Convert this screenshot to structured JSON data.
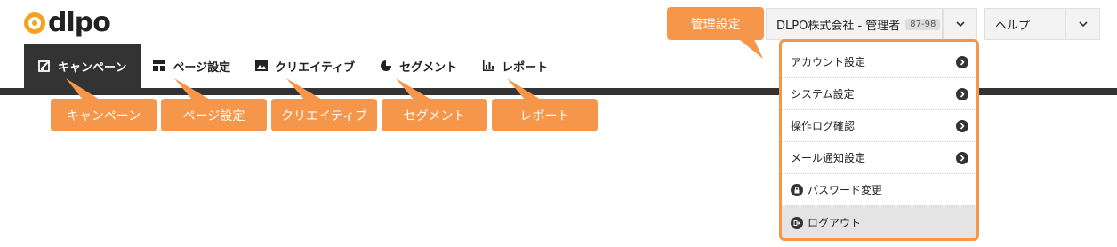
{
  "brand": {
    "logo_text": "dlpo",
    "accent": "#f5a31c",
    "callout_color": "#f5964a"
  },
  "nav": {
    "items": [
      {
        "label": "キャンペーン",
        "icon": "campaign-edit-icon",
        "active": true
      },
      {
        "label": "ページ設定",
        "icon": "layout-icon",
        "active": false
      },
      {
        "label": "クリエイティブ",
        "icon": "image-icon",
        "active": false
      },
      {
        "label": "セグメント",
        "icon": "pie-chart-icon",
        "active": false
      },
      {
        "label": "レポート",
        "icon": "bar-chart-icon",
        "active": false
      }
    ]
  },
  "callouts": {
    "campaign": "キャンペーン",
    "page_settings": "ページ設定",
    "creative": "クリエイティブ",
    "segment": "セグメント",
    "report": "レポート",
    "admin_settings": "管理設定"
  },
  "header": {
    "company_label": "DLPO株式会社 - 管理者",
    "company_badge": "87-98",
    "help_label": "ヘルプ"
  },
  "dropdown": {
    "items": [
      {
        "label": "アカウント設定",
        "icon": "chevron-right-circle-icon"
      },
      {
        "label": "システム設定",
        "icon": "chevron-right-circle-icon"
      },
      {
        "label": "操作ログ確認",
        "icon": "chevron-right-circle-icon"
      },
      {
        "label": "メール通知設定",
        "icon": "chevron-right-circle-icon"
      },
      {
        "label": "パスワード変更",
        "icon": "lock-icon"
      },
      {
        "label": "ログアウト",
        "icon": "logout-icon"
      }
    ]
  }
}
